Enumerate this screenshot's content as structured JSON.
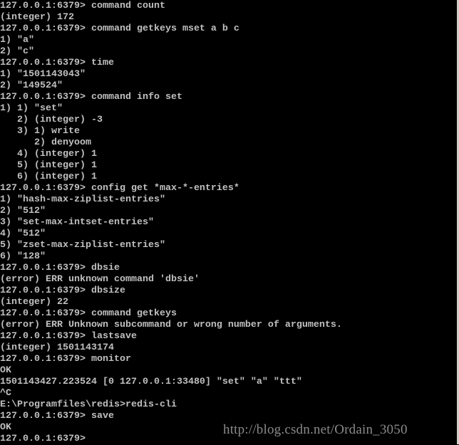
{
  "console": {
    "lines": [
      "127.0.0.1:6379> command count",
      "(integer) 172",
      "127.0.0.1:6379> command getkeys mset a b c",
      "1) \"a\"",
      "2) \"c\"",
      "127.0.0.1:6379> time",
      "1) \"1501143043\"",
      "2) \"149524\"",
      "127.0.0.1:6379> command info set",
      "1) 1) \"set\"",
      "   2) (integer) -3",
      "   3) 1) write",
      "      2) denyoom",
      "   4) (integer) 1",
      "   5) (integer) 1",
      "   6) (integer) 1",
      "127.0.0.1:6379> config get *max-*-entries*",
      "1) \"hash-max-ziplist-entries\"",
      "2) \"512\"",
      "3) \"set-max-intset-entries\"",
      "4) \"512\"",
      "5) \"zset-max-ziplist-entries\"",
      "6) \"128\"",
      "127.0.0.1:6379> dbsie",
      "(error) ERR unknown command 'dbsie'",
      "127.0.0.1:6379> dbsize",
      "(integer) 22",
      "127.0.0.1:6379> command getkeys",
      "(error) ERR Unknown subcommand or wrong number of arguments.",
      "127.0.0.1:6379> lastsave",
      "(integer) 1501143174",
      "127.0.0.1:6379> monitor",
      "OK",
      "1501143427.223524 [0 127.0.0.1:33480] \"set\" \"a\" \"ttt\"",
      "^C",
      "E:\\Programfiles\\redis>redis-cli",
      "127.0.0.1:6379> save",
      "OK",
      "127.0.0.1:6379>"
    ]
  },
  "watermark": "http://blog.csdn.net/Ordain_3050",
  "colors": {
    "background": "#000000",
    "text": "#c0c0c0",
    "watermark": "#8a8a8a"
  }
}
